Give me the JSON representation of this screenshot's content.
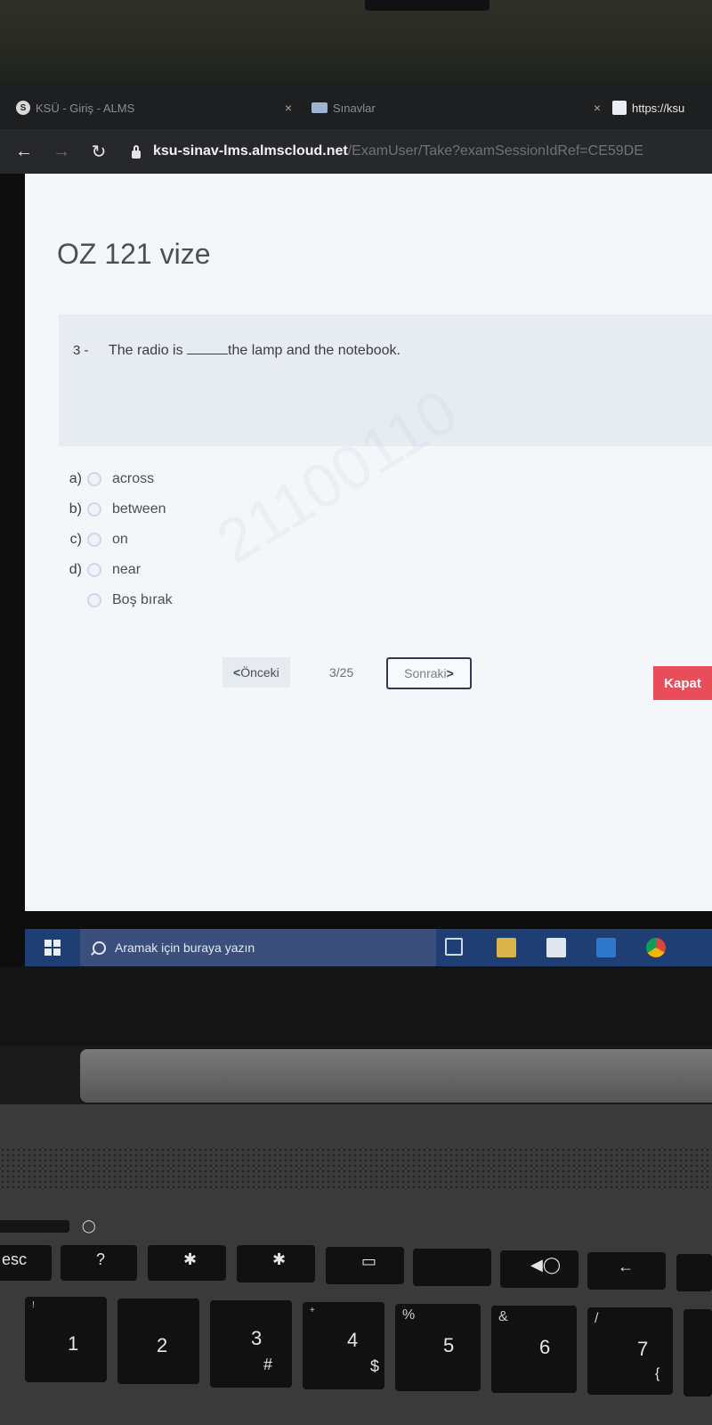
{
  "browser": {
    "tabs": [
      {
        "title": "KSÜ - Giriş - ALMS",
        "close": "×"
      },
      {
        "title": "Sınavlar",
        "close": "×"
      },
      {
        "title": "https://ksu"
      }
    ],
    "url_host": "ksu-sinav-lms.almscloud.net",
    "url_path": "/ExamUser/Take?examSessionIdRef=CE59DE"
  },
  "exam": {
    "title": "OZ 121 vize",
    "question_number": "3 -",
    "question_before": "The radio is ",
    "question_after": "the lamp and the notebook.",
    "options": [
      {
        "letter": "a)",
        "label": "across"
      },
      {
        "letter": "b)",
        "label": "between"
      },
      {
        "letter": "c)",
        "label": "on"
      },
      {
        "letter": "d)",
        "label": "near"
      },
      {
        "letter": "",
        "label": "Boş bırak"
      }
    ],
    "watermark": "21100110",
    "prev_label": "Önceki",
    "page_count": "3/25",
    "next_label": "Sonraki",
    "close_label": "Kapat"
  },
  "taskbar": {
    "search_placeholder": "Aramak için buraya yazın"
  },
  "keyboard": {
    "esc": "esc",
    "fkeys": [
      "?",
      "✱",
      "✱",
      "▭",
      "",
      "◀◯",
      "←"
    ],
    "numbers": [
      "1",
      "2",
      "3",
      "4",
      "5",
      "6",
      "7"
    ],
    "shifted": [
      "!",
      "",
      "",
      "+",
      "%",
      "&",
      "/"
    ],
    "symbols": [
      "",
      "",
      "#",
      "$",
      "",
      "",
      "{"
    ]
  },
  "colors": {
    "accent_close": "#e84e5a",
    "taskbar": "#1f3e73"
  }
}
